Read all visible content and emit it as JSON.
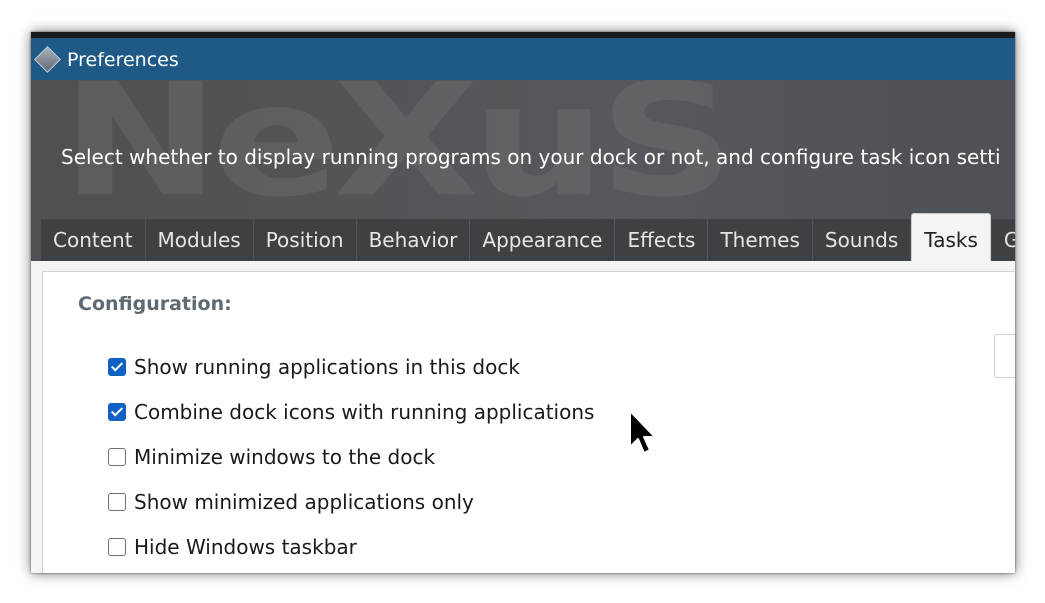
{
  "window": {
    "title": "Preferences",
    "icon": "diamond-app-icon"
  },
  "banner": {
    "watermark": "NeXuS",
    "description": "Select whether to display running programs on your dock or not, and configure task icon setti"
  },
  "tabs": [
    {
      "label": "Content",
      "active": false
    },
    {
      "label": "Modules",
      "active": false
    },
    {
      "label": "Position",
      "active": false
    },
    {
      "label": "Behavior",
      "active": false
    },
    {
      "label": "Appearance",
      "active": false
    },
    {
      "label": "Effects",
      "active": false
    },
    {
      "label": "Themes",
      "active": false
    },
    {
      "label": "Sounds",
      "active": false
    },
    {
      "label": "Tasks",
      "active": true
    },
    {
      "label": "Ge",
      "active": false
    }
  ],
  "configuration": {
    "heading": "Configuration:",
    "options": [
      {
        "label": "Show running applications in this dock",
        "checked": true
      },
      {
        "label": "Combine dock icons with running applications",
        "checked": true
      },
      {
        "label": "Minimize windows to the dock",
        "checked": false
      },
      {
        "label": "Show minimized applications only",
        "checked": false
      },
      {
        "label": "Hide Windows taskbar",
        "checked": false
      }
    ]
  },
  "colors": {
    "titlebar": "#1f5a86",
    "checkbox_checked": "#0f62c2",
    "section_label": "#5e6a73"
  }
}
